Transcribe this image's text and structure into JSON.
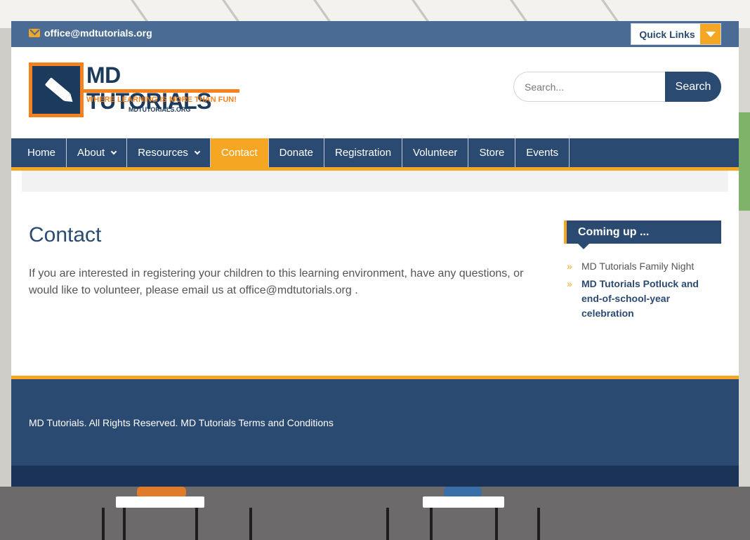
{
  "topbar": {
    "email": "office@mdtutorials.org",
    "quick_links_label": "Quick Links"
  },
  "logo": {
    "title": "MD TUTORIALS",
    "tagline": "WHERE LEARNING IS MORE THAN FUN!",
    "url": "MDTUTORIALS.ORG"
  },
  "search": {
    "placeholder": "Search...",
    "button_label": "Search"
  },
  "nav": {
    "items": [
      {
        "label": "Home"
      },
      {
        "label": "About"
      },
      {
        "label": "Resources"
      },
      {
        "label": "Contact"
      },
      {
        "label": "Donate"
      },
      {
        "label": "Registration"
      },
      {
        "label": "Volunteer"
      },
      {
        "label": "Store"
      },
      {
        "label": "Events"
      }
    ],
    "active": "Contact"
  },
  "main": {
    "title": "Contact",
    "body": "If you are interested in registering your children to this learning environment, have any questions, or would like to volunteer, please email us at office@mdtutorials.org ."
  },
  "sidebar": {
    "widget_title": "Coming up ...",
    "events": [
      {
        "label": "MD Tutorials Family Night"
      },
      {
        "label": "MD Tutorials Potluck and end-of-school-year celebration"
      }
    ]
  },
  "footer": {
    "text": "MD Tutorials. All Rights Reserved. MD Tutorials Terms and Conditions"
  },
  "colors": {
    "primary": "#2b4a72",
    "topbar": "#4a6b94",
    "accent": "#f5a623"
  }
}
